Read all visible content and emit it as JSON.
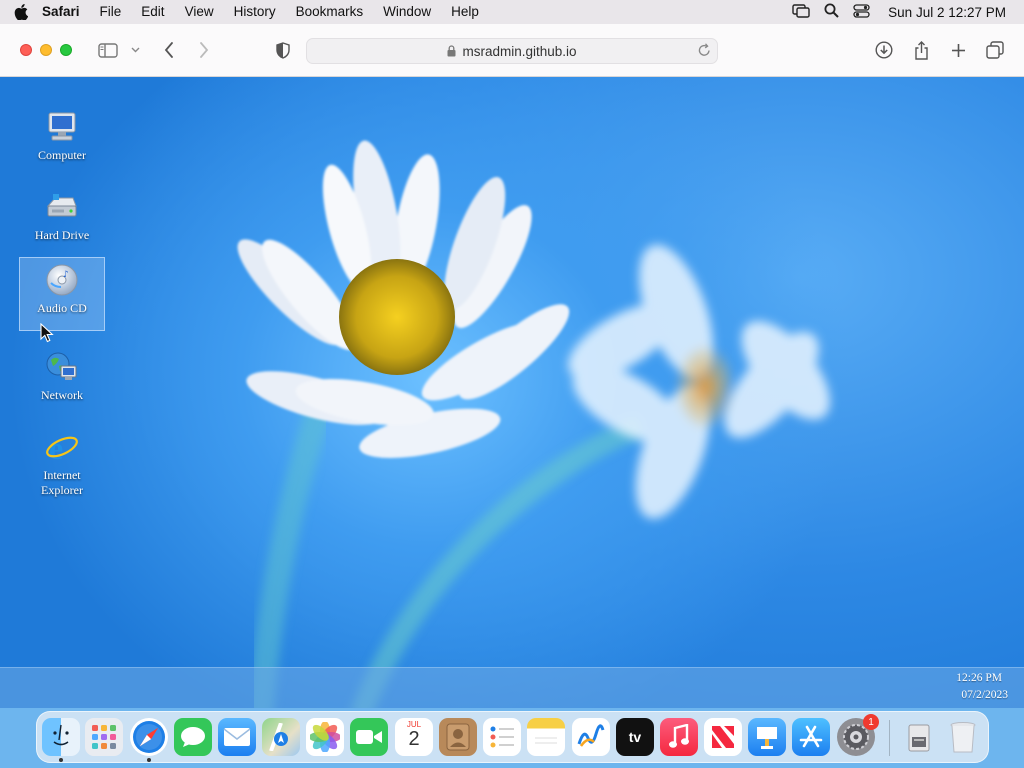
{
  "menubar": {
    "app_name": "Safari",
    "items": [
      "File",
      "Edit",
      "View",
      "History",
      "Bookmarks",
      "Window",
      "Help"
    ],
    "clock": "Sun Jul 2  12:27 PM"
  },
  "toolbar": {
    "url": "msradmin.github.io"
  },
  "desktop": {
    "icons": [
      {
        "label": "Computer",
        "icon": "computer-icon"
      },
      {
        "label": "Hard Drive",
        "icon": "hard-drive-icon"
      },
      {
        "label": "Audio CD",
        "icon": "audio-cd-icon",
        "selected": true
      },
      {
        "label": "Network",
        "icon": "network-icon"
      },
      {
        "label": "Internet\nExplorer",
        "icon": "internet-explorer-icon"
      }
    ],
    "taskbar": {
      "time": "12:26 PM",
      "date": "07/2/2023"
    }
  },
  "dock": {
    "calendar_month": "JUL",
    "calendar_day": "2",
    "appletv_label": "tv",
    "settings_badge": "1"
  },
  "colors": {
    "desktop_blue": "#2a8ae8",
    "taskbar": "#6eaae6"
  }
}
